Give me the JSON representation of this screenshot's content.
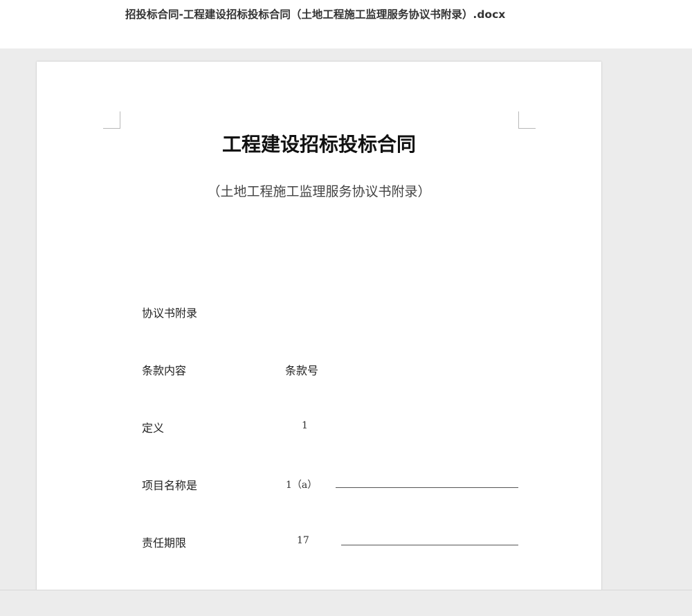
{
  "window": {
    "title": "招投标合同-工程建设招标投标合同（土地工程施工监理服务协议书附录）.docx"
  },
  "document": {
    "heading": "工程建设招标投标合同",
    "subheading": "（土地工程施工监理服务协议书附录）",
    "section_title": "协议书附录",
    "columns": {
      "content": "条款内容",
      "clause_no": "条款号"
    },
    "rows": [
      {
        "content": "定义",
        "clause_no": "1",
        "has_blank": false
      },
      {
        "content": "项目名称是",
        "clause_no": "1（a）",
        "has_blank": true
      },
      {
        "content": "责任期限",
        "clause_no": "17",
        "has_blank": true
      }
    ]
  },
  "colors": {
    "viewer_background": "#ececec",
    "page_background": "#ffffff",
    "text": "#222222"
  }
}
